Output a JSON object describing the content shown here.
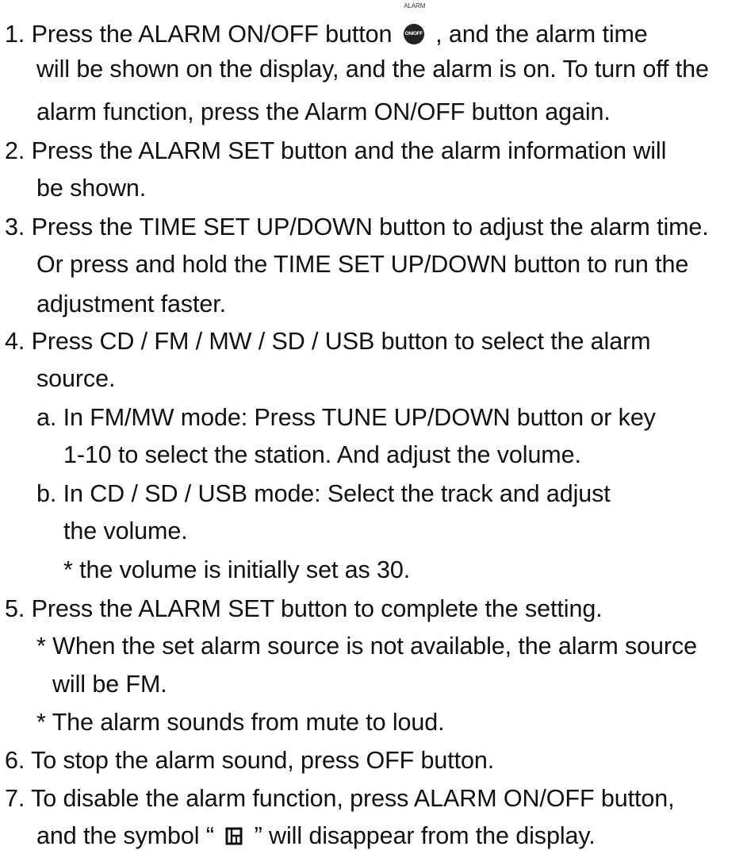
{
  "steps": {
    "s1": {
      "l1a": "1. Press the ALARM ON/OFF button",
      "l1b": ", and the alarm time",
      "l2": "will be shown on the display, and the alarm is on. To turn off the",
      "l3": "alarm function, press the Alarm ON/OFF button again.",
      "icon": {
        "caption": "ALARM",
        "label": "ON/OFF",
        "name": "alarm-on-off-button-icon"
      }
    },
    "s2": {
      "l1": "2. Press the ALARM SET button and the alarm information will",
      "l2": "be shown."
    },
    "s3": {
      "l1": "3. Press the TIME SET UP/DOWN button to adjust the alarm time.",
      "l2": "Or press and hold the TIME SET UP/DOWN button to run the",
      "l3": "adjustment faster."
    },
    "s4": {
      "l1": "4. Press CD / FM / MW / SD / USB button to select the alarm",
      "l2": "source.",
      "a1": "a. In FM/MW mode: Press TUNE UP/DOWN button or key",
      "a2": "1-10 to select the station. And adjust the volume.",
      "b1": "b. In CD / SD / USB mode: Select the track and adjust",
      "b2": "the volume.",
      "note": "* the volume is initially set as 30."
    },
    "s5": {
      "l1": "5. Press the ALARM SET button to complete the setting.",
      "n1a": "* When the set alarm source is not available, the alarm source",
      "n1b": "will be FM.",
      "n2": "* The alarm sounds from mute to loud."
    },
    "s6": {
      "l1": "6. To stop the alarm sound, press OFF button."
    },
    "s7": {
      "l1": "7. To disable the alarm function, press ALARM ON/OFF button,",
      "l2a": "and the symbol “",
      "l2b": "” will disappear from the display.",
      "symbol_icon": "alarm-bell-lcd-symbol-icon"
    }
  }
}
